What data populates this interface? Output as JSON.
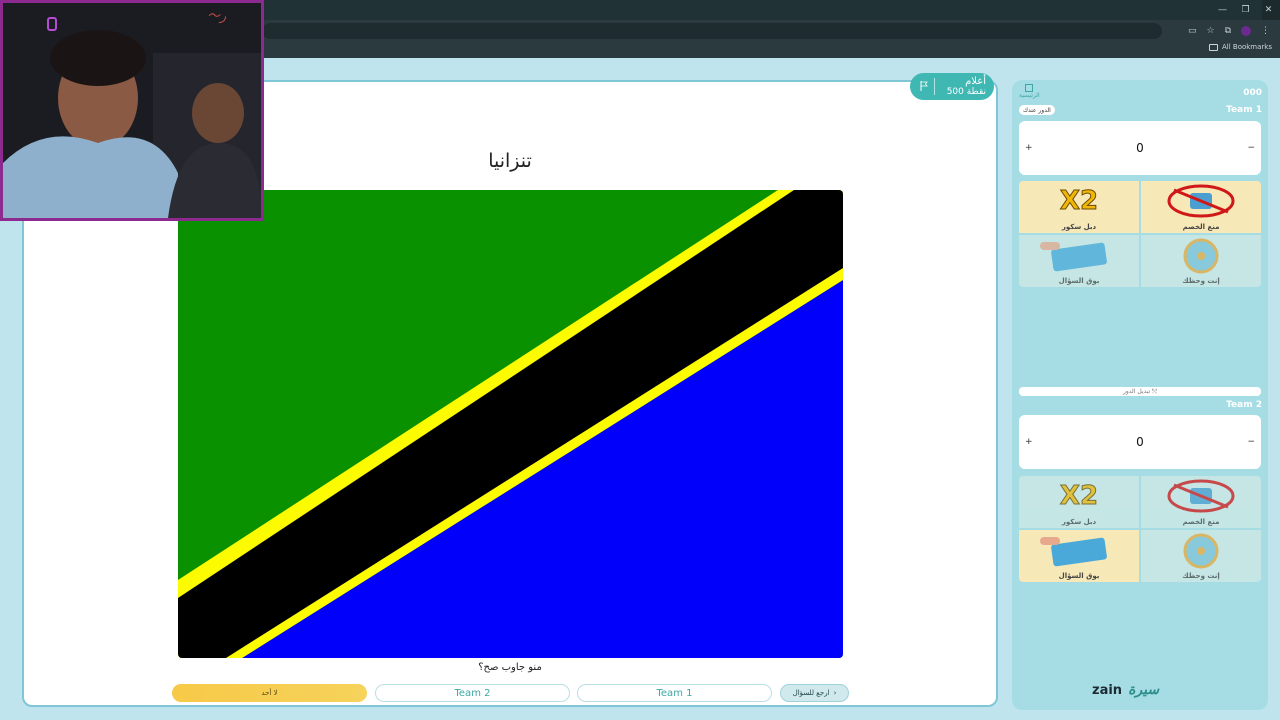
{
  "browser": {
    "window_controls": [
      "—",
      "❐",
      "✕"
    ],
    "bookmarks_label": "All Bookmarks"
  },
  "question": {
    "category": "أعلام",
    "points": "500 نقطة",
    "title": "تنزانيا",
    "who_answered": "منو جاوب صح؟",
    "flag_colors": {
      "green": "#0a9100",
      "yellow": "#fdfb00",
      "black": "#000000",
      "blue": "#0000fb"
    }
  },
  "answer_buttons": {
    "nobody": "لا أحد",
    "team2": "Team 2",
    "team1": "Team 1",
    "back": "ارجع للسؤال"
  },
  "sidebar": {
    "timer": "000",
    "home_label": "الرئيسية",
    "swap_turn": "تبديل الدور",
    "teams": [
      {
        "name": "Team 1",
        "turn_badge": "الدور عندك",
        "score": "0",
        "aids": [
          {
            "label": "منع الخصم",
            "icon": "block-opponent-icon"
          },
          {
            "label": "دبل سكور",
            "icon": "double-score-icon"
          },
          {
            "label": "إنت وحظك",
            "icon": "luck-wheel-icon"
          },
          {
            "label": "بوق السؤال",
            "icon": "steal-question-icon"
          }
        ]
      },
      {
        "name": "Team 2",
        "score": "0",
        "aids": [
          {
            "label": "منع الخصم",
            "icon": "block-opponent-icon"
          },
          {
            "label": "دبل سكور",
            "icon": "double-score-icon"
          },
          {
            "label": "إنت وحظك",
            "icon": "luck-wheel-icon"
          },
          {
            "label": "بوق السؤال",
            "icon": "steal-question-icon"
          }
        ]
      }
    ],
    "sponsor": "zain",
    "brand": "سيرة"
  },
  "webcam": {
    "label": "streamer webcam"
  }
}
